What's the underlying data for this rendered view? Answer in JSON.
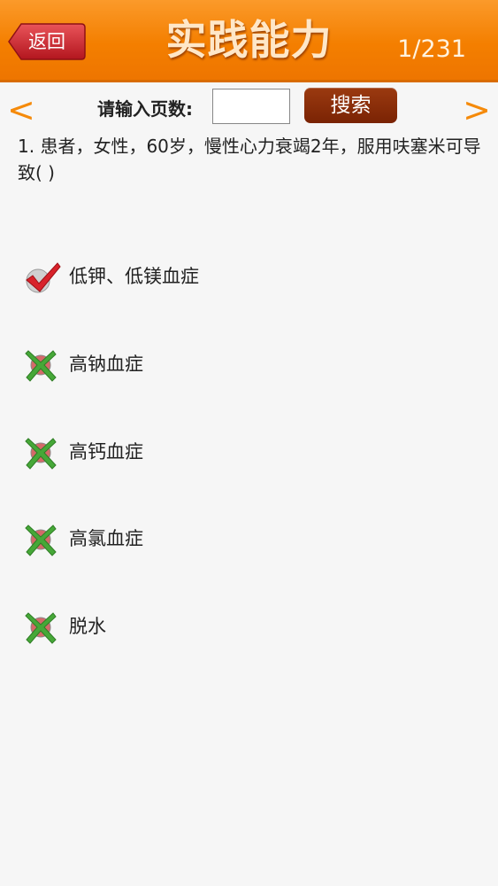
{
  "header": {
    "back_label": "返回",
    "title": "实践能力",
    "page_count": "1/231"
  },
  "search": {
    "label": "请输入页数:",
    "value": "",
    "button_label": "搜索",
    "prev_glyph": "<",
    "next_glyph": ">"
  },
  "question": {
    "text": "1. 患者，女性，60岁，慢性心力衰竭2年，服用呋塞米可导致(      )"
  },
  "options": [
    {
      "label": "低钾、低镁血症",
      "status": "correct"
    },
    {
      "label": "高钠血症",
      "status": "wrong"
    },
    {
      "label": "高钙血症",
      "status": "wrong"
    },
    {
      "label": "高氯血症",
      "status": "wrong"
    },
    {
      "label": "脱水",
      "status": "wrong"
    }
  ],
  "colors": {
    "header_orange": "#f47f00",
    "arrow_orange": "#f58a0a",
    "back_button_red": "#c8242b",
    "search_button_brown": "#8a2d08",
    "check_red": "#d8222a",
    "cross_green": "#46a838"
  },
  "icons": {
    "correct": "check-mark-icon",
    "wrong": "cross-mark-icon"
  }
}
